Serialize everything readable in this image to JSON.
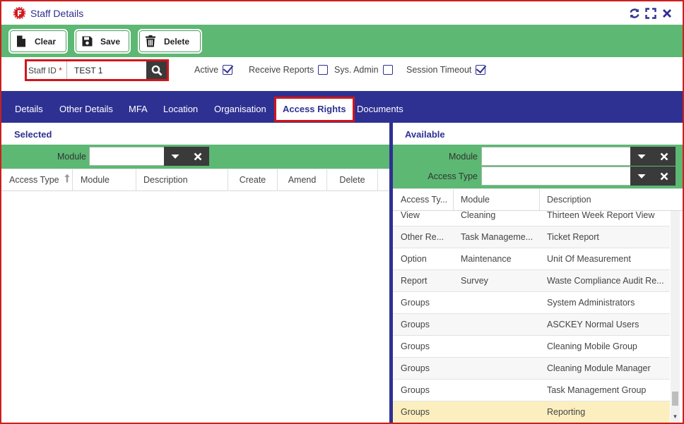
{
  "window": {
    "title": "Staff Details"
  },
  "toolbar": {
    "clear_label": "Clear",
    "save_label": "Save",
    "delete_label": "Delete"
  },
  "header": {
    "staff_id_label": "Staff ID",
    "required_mark": "*",
    "staff_id_value": "TEST 1",
    "active_label": "Active",
    "active_checked": true,
    "receive_reports_label": "Receive Reports",
    "receive_reports_checked": false,
    "sys_admin_label": "Sys. Admin",
    "sys_admin_checked": false,
    "session_timeout_label": "Session Timeout",
    "session_timeout_checked": true
  },
  "tabs": [
    {
      "label": "Details",
      "active": false
    },
    {
      "label": "Other Details",
      "active": false
    },
    {
      "label": "MFA",
      "active": false
    },
    {
      "label": "Location",
      "active": false
    },
    {
      "label": "Organisation",
      "active": false
    },
    {
      "label": "Access Rights",
      "active": true
    },
    {
      "label": "Documents",
      "active": false
    }
  ],
  "selected_panel": {
    "title": "Selected",
    "module_filter_label": "Module",
    "module_filter_value": "",
    "columns": [
      "Access Type",
      "Module",
      "Description",
      "Create",
      "Amend",
      "Delete"
    ],
    "rows": []
  },
  "available_panel": {
    "title": "Available",
    "module_filter_label": "Module",
    "module_filter_value": "",
    "access_type_filter_label": "Access Type",
    "access_type_filter_value": "",
    "columns": [
      "Access Ty...",
      "Module",
      "Description"
    ],
    "rows": [
      {
        "access_type": "View",
        "module": "Cleaning",
        "description": "Thirteen Week Report View"
      },
      {
        "access_type": "Other Re...",
        "module": "Task Manageme...",
        "description": "Ticket Report"
      },
      {
        "access_type": "Option",
        "module": "Maintenance",
        "description": "Unit Of Measurement"
      },
      {
        "access_type": "Report",
        "module": "Survey",
        "description": "Waste Compliance Audit Re..."
      },
      {
        "access_type": "Groups",
        "module": "",
        "description": "System Administrators"
      },
      {
        "access_type": "Groups",
        "module": "",
        "description": "ASCKEY Normal Users"
      },
      {
        "access_type": "Groups",
        "module": "",
        "description": "Cleaning Mobile Group"
      },
      {
        "access_type": "Groups",
        "module": "",
        "description": "Cleaning Module Manager"
      },
      {
        "access_type": "Groups",
        "module": "",
        "description": "Task Management Group"
      },
      {
        "access_type": "Groups",
        "module": "",
        "description": "Reporting"
      }
    ],
    "selected_row_index": 9
  },
  "colors": {
    "brand_blue": "#2e3192",
    "toolbar_green": "#5cb873",
    "highlight_red": "#d1161b",
    "selected_row": "#fcefbf"
  },
  "icons": {
    "app": "app-logo-icon",
    "refresh": "refresh-icon",
    "maximize": "maximize-icon",
    "close": "close-icon",
    "clear": "new-document-icon",
    "save": "floppy-disk-icon",
    "delete": "trash-icon",
    "search": "search-icon",
    "dropdown": "chevron-down-icon",
    "clear_filter": "clear-x-icon",
    "sort": "sort-ascending-icon"
  }
}
